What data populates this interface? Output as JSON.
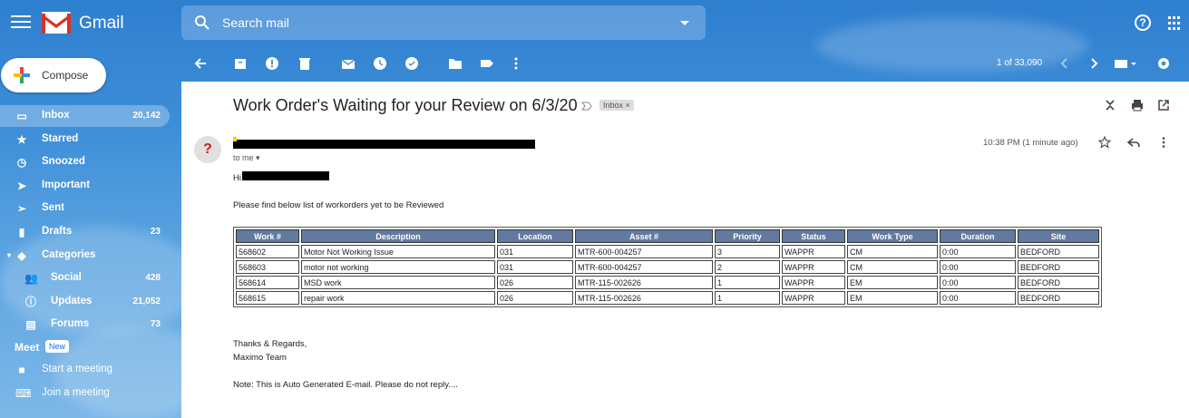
{
  "app": {
    "name": "Gmail"
  },
  "search": {
    "placeholder": "Search mail"
  },
  "compose": {
    "label": "Compose"
  },
  "sidebar": {
    "items": [
      {
        "label": "Inbox",
        "count": "20,142",
        "icon": "inbox-icon"
      },
      {
        "label": "Starred",
        "count": "",
        "icon": "star-icon"
      },
      {
        "label": "Snoozed",
        "count": "",
        "icon": "clock-icon"
      },
      {
        "label": "Important",
        "count": "",
        "icon": "important-icon"
      },
      {
        "label": "Sent",
        "count": "",
        "icon": "send-icon"
      },
      {
        "label": "Drafts",
        "count": "23",
        "icon": "draft-icon"
      },
      {
        "label": "Categories",
        "count": "",
        "icon": "label-icon"
      },
      {
        "label": "Social",
        "count": "428",
        "icon": "people-icon"
      },
      {
        "label": "Updates",
        "count": "21,052",
        "icon": "info-icon"
      },
      {
        "label": "Forums",
        "count": "73",
        "icon": "forum-icon"
      }
    ],
    "meet": {
      "title": "Meet",
      "badge": "New",
      "start": "Start a meeting",
      "join": "Join a meeting"
    }
  },
  "toolbar": {
    "pagination": "1 of 33,090"
  },
  "email": {
    "subject": "Work Order's Waiting for your Review on 6/3/20",
    "label": "Inbox",
    "to": "to me",
    "time": "10:38 PM (1 minute ago)",
    "greeting": "Hi",
    "intro": "Please find below list of workorders yet to be Reviewed",
    "table": {
      "headers": [
        "Work #",
        "Description",
        "Location",
        "Asset #",
        "Priority",
        "Status",
        "Work Type",
        "Duration",
        "Site"
      ],
      "rows": [
        [
          "568602",
          "Motor Not Working Issue",
          "031",
          "MTR-600-004257",
          "3",
          "WAPPR",
          "CM",
          "0:00",
          "BEDFORD"
        ],
        [
          "568603",
          "motor not working",
          "031",
          "MTR-600-004257",
          "2",
          "WAPPR",
          "CM",
          "0:00",
          "BEDFORD"
        ],
        [
          "568614",
          "MSD work",
          "026",
          "MTR-115-002626",
          "1",
          "WAPPR",
          "EM",
          "0:00",
          "BEDFORD"
        ],
        [
          "568615",
          "repair work",
          "026",
          "MTR-115-002626",
          "1",
          "WAPPR",
          "EM",
          "0:00",
          "BEDFORD"
        ]
      ]
    },
    "regards": "Thanks & Regards,",
    "team": "Maximo Team",
    "note": "Note: This is Auto Generated E-mail. Please do not reply...."
  },
  "colors": {
    "header_bg": "#627aa0",
    "accent": "#1a73e8"
  }
}
